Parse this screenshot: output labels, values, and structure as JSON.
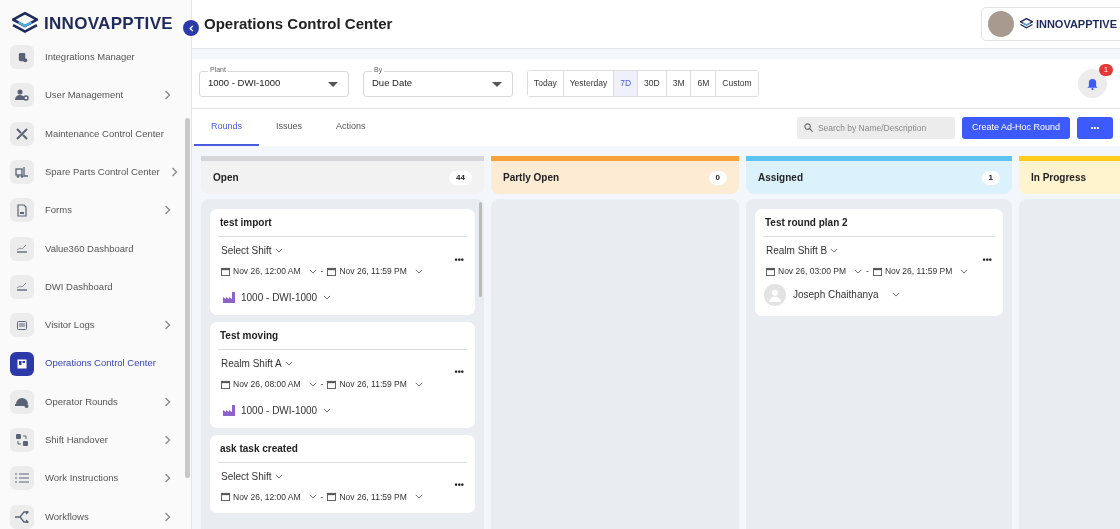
{
  "sidebar": {
    "logo": "INNOVAPPTIVE",
    "items": [
      {
        "label": "Integrations Manager",
        "kind": "database",
        "submenu": false,
        "selected": false
      },
      {
        "label": "User Management",
        "kind": "user-gear",
        "submenu": true,
        "selected": false
      },
      {
        "label": "Maintenance Control Center",
        "kind": "tools",
        "submenu": false,
        "selected": false
      },
      {
        "label": "Spare Parts Control Center",
        "kind": "forklift",
        "submenu": true,
        "selected": false
      },
      {
        "label": "Forms",
        "kind": "document",
        "submenu": true,
        "selected": false
      },
      {
        "label": "Value360 Dashboard",
        "kind": "chart",
        "submenu": false,
        "selected": false
      },
      {
        "label": "DWI Dashboard",
        "kind": "chart",
        "submenu": false,
        "selected": false
      },
      {
        "label": "Visitor Logs",
        "kind": "log",
        "submenu": true,
        "selected": false
      },
      {
        "label": "Operations Control Center",
        "kind": "panel",
        "submenu": false,
        "selected": true
      },
      {
        "label": "Operator Rounds",
        "kind": "helmet",
        "submenu": true,
        "selected": false
      },
      {
        "label": "Shift Handover",
        "kind": "swap",
        "submenu": true,
        "selected": false
      },
      {
        "label": "Work Instructions",
        "kind": "list",
        "submenu": true,
        "selected": false
      },
      {
        "label": "Workflows",
        "kind": "split",
        "submenu": true,
        "selected": false
      }
    ]
  },
  "header": {
    "title": "Operations Control Center",
    "brand": "INNOVAPPTIVE"
  },
  "filters": {
    "plant": {
      "label": "Plant",
      "value": "1000 - DWI-1000"
    },
    "by": {
      "label": "By",
      "value": "Due Date"
    },
    "ranges": [
      {
        "label": "Today",
        "selected": false
      },
      {
        "label": "Yesterday",
        "selected": false
      },
      {
        "label": "7D",
        "selected": true
      },
      {
        "label": "30D",
        "selected": false
      },
      {
        "label": "3M",
        "selected": false
      },
      {
        "label": "6M",
        "selected": false
      },
      {
        "label": "Custom",
        "selected": false
      }
    ],
    "notifications": "1"
  },
  "tabs": [
    {
      "label": "Rounds",
      "selected": true
    },
    {
      "label": "Issues",
      "selected": false
    },
    {
      "label": "Actions",
      "selected": false
    }
  ],
  "search": {
    "placeholder": "Search by Name/Description"
  },
  "create_button": "Create Ad-Hoc Round",
  "more_button": "•••",
  "columns": [
    {
      "title": "Open",
      "count": "44",
      "color": "#d4d6d9",
      "cards": [
        {
          "title": "test import",
          "shift": "Select Shift",
          "start": "Nov 26, 12:00 AM",
          "separator": "-",
          "end": "Nov 26, 11:59 PM",
          "kind": "plant",
          "value": "1000 - DWI-1000"
        },
        {
          "title": "Test moving",
          "shift": "Realm Shift A",
          "start": "Nov 26, 08:00 AM",
          "separator": "-",
          "end": "Nov 26, 11:59 PM",
          "kind": "plant",
          "value": "1000 - DWI-1000"
        },
        {
          "title": "ask task created",
          "shift": "Select Shift",
          "start": "Nov 26, 12:00 AM",
          "separator": "-",
          "end": "Nov 26, 11:59 PM"
        }
      ]
    },
    {
      "title": "Partly Open",
      "count": "0",
      "color": "#f7a23b"
    },
    {
      "title": "Assigned",
      "count": "1",
      "color": "#5bc4f1",
      "cards": [
        {
          "title": "Test round plan 2",
          "shift": "Realm Shift B",
          "start": "Nov 26, 03:00 PM",
          "separator": "-",
          "end": "Nov 26, 11:59 PM",
          "kind": "assignee",
          "value": "Joseph Chaithanya"
        }
      ]
    },
    {
      "title": "In Progress",
      "color": "#ffcc1a"
    }
  ]
}
